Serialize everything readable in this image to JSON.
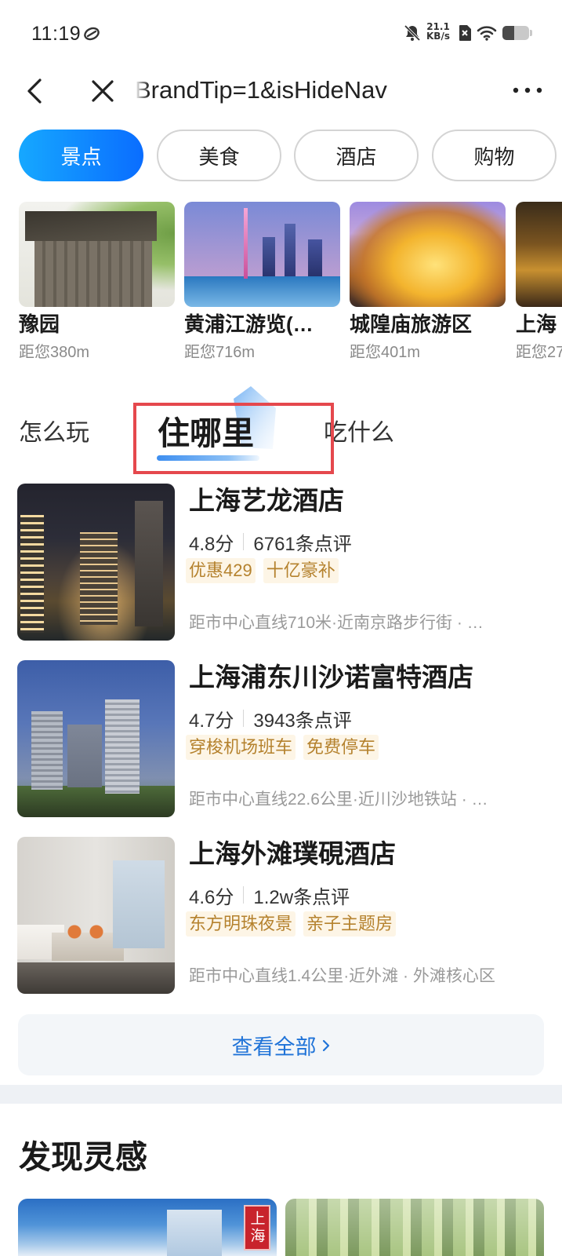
{
  "status_bar": {
    "time": "11:19",
    "net_speed": "21.1",
    "net_speed_unit": "KB/s",
    "battery_level": 0.45,
    "icons": {
      "sync": "sync-icon",
      "mute": "bell-off-icon",
      "sim": "sim-off-icon",
      "wifi": "wifi-icon",
      "battery": "battery-icon"
    }
  },
  "nav": {
    "url_text": "BrandTip=1&isHideNav",
    "icons": {
      "back": "back-arrow-icon",
      "close": "close-icon",
      "more": "more-dots-icon"
    }
  },
  "categories": [
    {
      "label": "景点",
      "selected": true
    },
    {
      "label": "美食",
      "selected": false
    },
    {
      "label": "酒店",
      "selected": false
    },
    {
      "label": "购物",
      "selected": false
    }
  ],
  "attractions": [
    {
      "name": "豫园",
      "distance": "距您380m"
    },
    {
      "name": "黄浦江游览(…",
      "distance": "距您716m"
    },
    {
      "name": "城隍庙旅游区",
      "distance": "距您401m"
    },
    {
      "name": "上海",
      "distance": "距您27"
    }
  ],
  "tabs": [
    {
      "label": "怎么玩",
      "selected": false
    },
    {
      "label": "住哪里",
      "selected": true
    },
    {
      "label": "吃什么",
      "selected": false
    }
  ],
  "hotels": [
    {
      "name": "上海艺龙酒店",
      "score": "4.8分",
      "reviews": "6761条点评",
      "tags": [
        "优惠429",
        "十亿豪补"
      ],
      "location": "距市中心直线710米·近南京路步行街 · …"
    },
    {
      "name": "上海浦东川沙诺富特酒店",
      "score": "4.7分",
      "reviews": "3943条点评",
      "tags": [
        "穿梭机场班车",
        "免费停车"
      ],
      "location": "距市中心直线22.6公里·近川沙地铁站 · …"
    },
    {
      "name": "上海外滩璞硯酒店",
      "score": "4.6分",
      "reviews": "1.2w条点评",
      "tags": [
        "东方明珠夜景",
        "亲子主题房"
      ],
      "location": "距市中心直线1.4公里·近外滩 · 外滩核心区"
    }
  ],
  "view_all": {
    "label": "查看全部",
    "icon": "chevron-right-icon"
  },
  "inspiration": {
    "title": "发现灵感",
    "cards": [
      {
        "badge": "上海"
      },
      {}
    ]
  },
  "colors": {
    "accent": "#0a6dff",
    "accent_light": "#16a8ff",
    "tag_text": "#b5822e",
    "tag_bg": "#fdf5e6",
    "link": "#1f73d8",
    "highlight_box": "#e5484d",
    "divider": "#eef1f5"
  }
}
